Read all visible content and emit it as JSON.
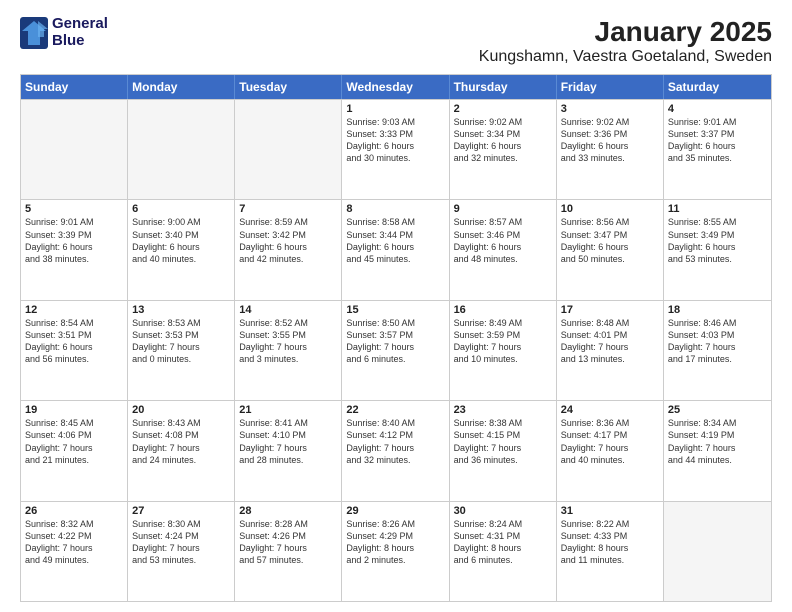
{
  "logo": {
    "line1": "General",
    "line2": "Blue"
  },
  "title": "January 2025",
  "subtitle": "Kungshamn, Vaestra Goetaland, Sweden",
  "header_days": [
    "Sunday",
    "Monday",
    "Tuesday",
    "Wednesday",
    "Thursday",
    "Friday",
    "Saturday"
  ],
  "weeks": [
    [
      {
        "day": "",
        "text": ""
      },
      {
        "day": "",
        "text": ""
      },
      {
        "day": "",
        "text": ""
      },
      {
        "day": "1",
        "text": "Sunrise: 9:03 AM\nSunset: 3:33 PM\nDaylight: 6 hours\nand 30 minutes."
      },
      {
        "day": "2",
        "text": "Sunrise: 9:02 AM\nSunset: 3:34 PM\nDaylight: 6 hours\nand 32 minutes."
      },
      {
        "day": "3",
        "text": "Sunrise: 9:02 AM\nSunset: 3:36 PM\nDaylight: 6 hours\nand 33 minutes."
      },
      {
        "day": "4",
        "text": "Sunrise: 9:01 AM\nSunset: 3:37 PM\nDaylight: 6 hours\nand 35 minutes."
      }
    ],
    [
      {
        "day": "5",
        "text": "Sunrise: 9:01 AM\nSunset: 3:39 PM\nDaylight: 6 hours\nand 38 minutes."
      },
      {
        "day": "6",
        "text": "Sunrise: 9:00 AM\nSunset: 3:40 PM\nDaylight: 6 hours\nand 40 minutes."
      },
      {
        "day": "7",
        "text": "Sunrise: 8:59 AM\nSunset: 3:42 PM\nDaylight: 6 hours\nand 42 minutes."
      },
      {
        "day": "8",
        "text": "Sunrise: 8:58 AM\nSunset: 3:44 PM\nDaylight: 6 hours\nand 45 minutes."
      },
      {
        "day": "9",
        "text": "Sunrise: 8:57 AM\nSunset: 3:46 PM\nDaylight: 6 hours\nand 48 minutes."
      },
      {
        "day": "10",
        "text": "Sunrise: 8:56 AM\nSunset: 3:47 PM\nDaylight: 6 hours\nand 50 minutes."
      },
      {
        "day": "11",
        "text": "Sunrise: 8:55 AM\nSunset: 3:49 PM\nDaylight: 6 hours\nand 53 minutes."
      }
    ],
    [
      {
        "day": "12",
        "text": "Sunrise: 8:54 AM\nSunset: 3:51 PM\nDaylight: 6 hours\nand 56 minutes."
      },
      {
        "day": "13",
        "text": "Sunrise: 8:53 AM\nSunset: 3:53 PM\nDaylight: 7 hours\nand 0 minutes."
      },
      {
        "day": "14",
        "text": "Sunrise: 8:52 AM\nSunset: 3:55 PM\nDaylight: 7 hours\nand 3 minutes."
      },
      {
        "day": "15",
        "text": "Sunrise: 8:50 AM\nSunset: 3:57 PM\nDaylight: 7 hours\nand 6 minutes."
      },
      {
        "day": "16",
        "text": "Sunrise: 8:49 AM\nSunset: 3:59 PM\nDaylight: 7 hours\nand 10 minutes."
      },
      {
        "day": "17",
        "text": "Sunrise: 8:48 AM\nSunset: 4:01 PM\nDaylight: 7 hours\nand 13 minutes."
      },
      {
        "day": "18",
        "text": "Sunrise: 8:46 AM\nSunset: 4:03 PM\nDaylight: 7 hours\nand 17 minutes."
      }
    ],
    [
      {
        "day": "19",
        "text": "Sunrise: 8:45 AM\nSunset: 4:06 PM\nDaylight: 7 hours\nand 21 minutes."
      },
      {
        "day": "20",
        "text": "Sunrise: 8:43 AM\nSunset: 4:08 PM\nDaylight: 7 hours\nand 24 minutes."
      },
      {
        "day": "21",
        "text": "Sunrise: 8:41 AM\nSunset: 4:10 PM\nDaylight: 7 hours\nand 28 minutes."
      },
      {
        "day": "22",
        "text": "Sunrise: 8:40 AM\nSunset: 4:12 PM\nDaylight: 7 hours\nand 32 minutes."
      },
      {
        "day": "23",
        "text": "Sunrise: 8:38 AM\nSunset: 4:15 PM\nDaylight: 7 hours\nand 36 minutes."
      },
      {
        "day": "24",
        "text": "Sunrise: 8:36 AM\nSunset: 4:17 PM\nDaylight: 7 hours\nand 40 minutes."
      },
      {
        "day": "25",
        "text": "Sunrise: 8:34 AM\nSunset: 4:19 PM\nDaylight: 7 hours\nand 44 minutes."
      }
    ],
    [
      {
        "day": "26",
        "text": "Sunrise: 8:32 AM\nSunset: 4:22 PM\nDaylight: 7 hours\nand 49 minutes."
      },
      {
        "day": "27",
        "text": "Sunrise: 8:30 AM\nSunset: 4:24 PM\nDaylight: 7 hours\nand 53 minutes."
      },
      {
        "day": "28",
        "text": "Sunrise: 8:28 AM\nSunset: 4:26 PM\nDaylight: 7 hours\nand 57 minutes."
      },
      {
        "day": "29",
        "text": "Sunrise: 8:26 AM\nSunset: 4:29 PM\nDaylight: 8 hours\nand 2 minutes."
      },
      {
        "day": "30",
        "text": "Sunrise: 8:24 AM\nSunset: 4:31 PM\nDaylight: 8 hours\nand 6 minutes."
      },
      {
        "day": "31",
        "text": "Sunrise: 8:22 AM\nSunset: 4:33 PM\nDaylight: 8 hours\nand 11 minutes."
      },
      {
        "day": "",
        "text": ""
      }
    ]
  ]
}
